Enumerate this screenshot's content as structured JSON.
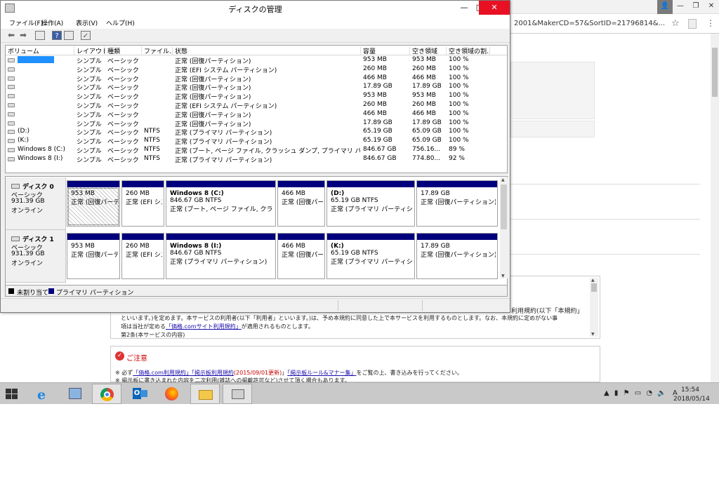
{
  "browser": {
    "url": "2001&MakerCD=57&SortID=21796814&...",
    "box_lines": [
      "といいます。)を定めます。本サービスの利用者(以下「利用者」といいます。)は、予め本規約に同意した上で本サービスを利用するものとします。なお、本規約に定めがない事",
      "項は当社が定める",
      "が適用されるものとします。",
      "第2条(本サービスの内容)"
    ],
    "box_right_text": "利用規約(以下「本規約」",
    "box_link": "「価格.comサイト利用規約」",
    "notice_title": "ご注意",
    "notice_line1_prefix": "※ 必ず",
    "notice_link1": "「価格.com利用規約」",
    "notice_link2": "「掲示板利用規約",
    "notice_update": "(2015/09/01更新)",
    "notice_link2_close": "」",
    "notice_link3": "「掲示板ルール&マナー集」",
    "notice_line1_suffix": "をご覧の上、書き込みを行ってください。",
    "notice_line2": "※ 掲示板に書き込まれた内容を二次利用(雑誌への掲載許可など)させて頂く場合もあります。"
  },
  "window": {
    "title": "ディスクの管理",
    "minimize": "—",
    "maximize": "□",
    "close": "✕"
  },
  "menu": [
    "ファイル(F)",
    "操作(A)",
    "表示(V)",
    "ヘルプ(H)"
  ],
  "columns": [
    "ボリューム",
    "レイアウト",
    "種類",
    "ファイル...",
    "状態",
    "容量",
    "空き領域",
    "空き領域の割..."
  ],
  "volumes": [
    {
      "name": "",
      "layout": "シンプル",
      "type": "ベーシック",
      "fs": "",
      "status": "正常 (回復パーティション)",
      "capacity": "953 MB",
      "free": "953 MB",
      "pct": "100 %",
      "selected": true
    },
    {
      "name": "",
      "layout": "シンプル",
      "type": "ベーシック",
      "fs": "",
      "status": "正常 (EFI システム パーティション)",
      "capacity": "260 MB",
      "free": "260 MB",
      "pct": "100 %"
    },
    {
      "name": "",
      "layout": "シンプル",
      "type": "ベーシック",
      "fs": "",
      "status": "正常 (回復パーティション)",
      "capacity": "466 MB",
      "free": "466 MB",
      "pct": "100 %"
    },
    {
      "name": "",
      "layout": "シンプル",
      "type": "ベーシック",
      "fs": "",
      "status": "正常 (回復パーティション)",
      "capacity": "17.89 GB",
      "free": "17.89 GB",
      "pct": "100 %"
    },
    {
      "name": "",
      "layout": "シンプル",
      "type": "ベーシック",
      "fs": "",
      "status": "正常 (回復パーティション)",
      "capacity": "953 MB",
      "free": "953 MB",
      "pct": "100 %"
    },
    {
      "name": "",
      "layout": "シンプル",
      "type": "ベーシック",
      "fs": "",
      "status": "正常 (EFI システム パーティション)",
      "capacity": "260 MB",
      "free": "260 MB",
      "pct": "100 %"
    },
    {
      "name": "",
      "layout": "シンプル",
      "type": "ベーシック",
      "fs": "",
      "status": "正常 (回復パーティション)",
      "capacity": "466 MB",
      "free": "466 MB",
      "pct": "100 %"
    },
    {
      "name": "",
      "layout": "シンプル",
      "type": "ベーシック",
      "fs": "",
      "status": "正常 (回復パーティション)",
      "capacity": "17.89 GB",
      "free": "17.89 GB",
      "pct": "100 %"
    },
    {
      "name": "(D:)",
      "layout": "シンプル",
      "type": "ベーシック",
      "fs": "NTFS",
      "status": "正常 (プライマリ パーティション)",
      "capacity": "65.19 GB",
      "free": "65.09 GB",
      "pct": "100 %"
    },
    {
      "name": "(K:)",
      "layout": "シンプル",
      "type": "ベーシック",
      "fs": "NTFS",
      "status": "正常 (プライマリ パーティション)",
      "capacity": "65.19 GB",
      "free": "65.09 GB",
      "pct": "100 %"
    },
    {
      "name": "Windows 8 (C:)",
      "layout": "シンプル",
      "type": "ベーシック",
      "fs": "NTFS",
      "status": "正常 (ブート, ページ ファイル, クラッシュ ダンプ, プライマリ パーティション)",
      "capacity": "846.67 GB",
      "free": "756.16...",
      "pct": "89 %"
    },
    {
      "name": "Windows 8 (I:)",
      "layout": "シンプル",
      "type": "ベーシック",
      "fs": "NTFS",
      "status": "正常 (プライマリ パーティション)",
      "capacity": "846.67 GB",
      "free": "774.80...",
      "pct": "92 %"
    }
  ],
  "disks": [
    {
      "name": "ディスク 0",
      "kind": "ベーシック",
      "size": "931.39 GB",
      "state": "オンライン",
      "partitions": [
        {
          "title": "",
          "size": "953 MB",
          "status": "正常 (回復パーティション)"
        },
        {
          "title": "",
          "size": "260 MB",
          "status": "正常 (EFI システム パーティション)"
        },
        {
          "title": "Windows 8  (C:)",
          "size": "846.67 GB NTFS",
          "status": "正常 (ブート, ページ ファイル, クラッシュ ダンプ, プライマリ パーティション)"
        },
        {
          "title": "",
          "size": "466 MB",
          "status": "正常 (回復パーティション)"
        },
        {
          "title": "(D:)",
          "size": "65.19 GB NTFS",
          "status": "正常 (プライマリ パーティション)"
        },
        {
          "title": "",
          "size": "17.89 GB",
          "status": "正常 (回復パーティション)"
        }
      ]
    },
    {
      "name": "ディスク 1",
      "kind": "ベーシック",
      "size": "931.39 GB",
      "state": "オンライン",
      "partitions": [
        {
          "title": "",
          "size": "953 MB",
          "status": "正常 (回復パーティション)"
        },
        {
          "title": "",
          "size": "260 MB",
          "status": "正常 (EFI システム パーティション)"
        },
        {
          "title": "Windows 8  (I:)",
          "size": "846.67 GB NTFS",
          "status": "正常 (プライマリ パーティション)"
        },
        {
          "title": "",
          "size": "466 MB",
          "status": "正常 (回復パーティション)"
        },
        {
          "title": "(K:)",
          "size": "65.19 GB NTFS",
          "status": "正常 (プライマリ パーティション)"
        },
        {
          "title": "",
          "size": "17.89 GB",
          "status": "正常 (回復パーティション)"
        }
      ]
    }
  ],
  "legend": [
    {
      "label": "未割り当て",
      "color": "#000000"
    },
    {
      "label": "プライマリ パーティション",
      "color": "#00007d"
    }
  ],
  "taskbar": {
    "time": "15:54",
    "date": "2018/05/14",
    "ime": "A"
  },
  "colors": {
    "partition_bar": "#00007d",
    "selection": "#1e90ff",
    "close_button": "#e81123"
  }
}
